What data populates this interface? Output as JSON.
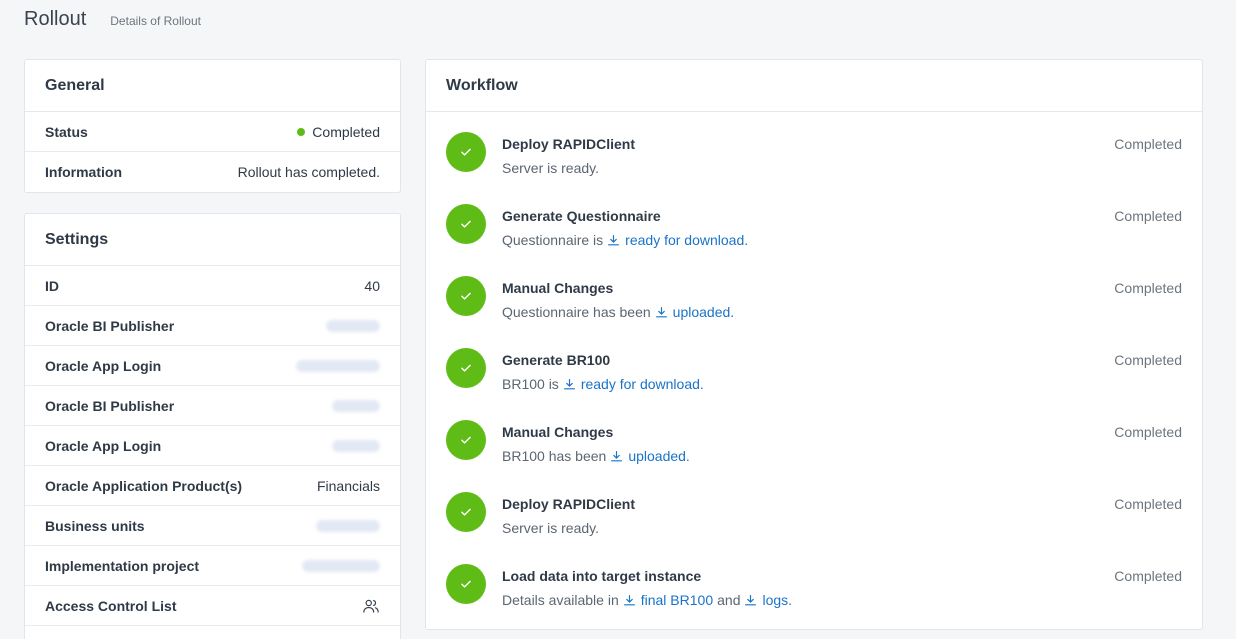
{
  "header": {
    "title": "Rollout",
    "subtitle": "Details of Rollout"
  },
  "general": {
    "title": "General",
    "rows": [
      {
        "label": "Status",
        "value": "Completed",
        "status_color": "#5fbb16"
      },
      {
        "label": "Information",
        "value": "Rollout has completed."
      }
    ]
  },
  "settings": {
    "title": "Settings",
    "rows": [
      {
        "label": "ID",
        "value": "40"
      },
      {
        "label": "Oracle BI Publisher",
        "value": ""
      },
      {
        "label": "Oracle App Login",
        "value": ""
      },
      {
        "label": "Oracle BI Publisher",
        "value": ""
      },
      {
        "label": "Oracle App Login",
        "value": ""
      },
      {
        "label": "Oracle Application Product(s)",
        "value": "Financials"
      },
      {
        "label": "Business units",
        "value": ""
      },
      {
        "label": "Implementation project",
        "value": ""
      },
      {
        "label": "Access Control List",
        "icon": "users-icon"
      }
    ]
  },
  "workflow": {
    "title": "Workflow",
    "steps": [
      {
        "title": "Deploy RAPIDClient",
        "status": "Completed",
        "desc": "Server is ready."
      },
      {
        "title": "Generate Questionnaire",
        "status": "Completed",
        "desc": "Questionnaire is",
        "link1": "ready for download."
      },
      {
        "title": "Manual Changes",
        "status": "Completed",
        "desc": "Questionnaire has been",
        "link1": "uploaded."
      },
      {
        "title": "Generate BR100",
        "status": "Completed",
        "desc": "BR100 is",
        "link1": "ready for download."
      },
      {
        "title": "Manual Changes",
        "status": "Completed",
        "desc": "BR100 has been",
        "link1": "uploaded."
      },
      {
        "title": "Deploy RAPIDClient",
        "status": "Completed",
        "desc": "Server is ready."
      },
      {
        "title": "Load data into target instance",
        "status": "Completed",
        "desc": "Details available in",
        "link1": "final BR100",
        "mid": "and",
        "link2": "logs."
      }
    ]
  },
  "colors": {
    "accent_green": "#5fbb16",
    "link_blue": "#1a73c7"
  }
}
